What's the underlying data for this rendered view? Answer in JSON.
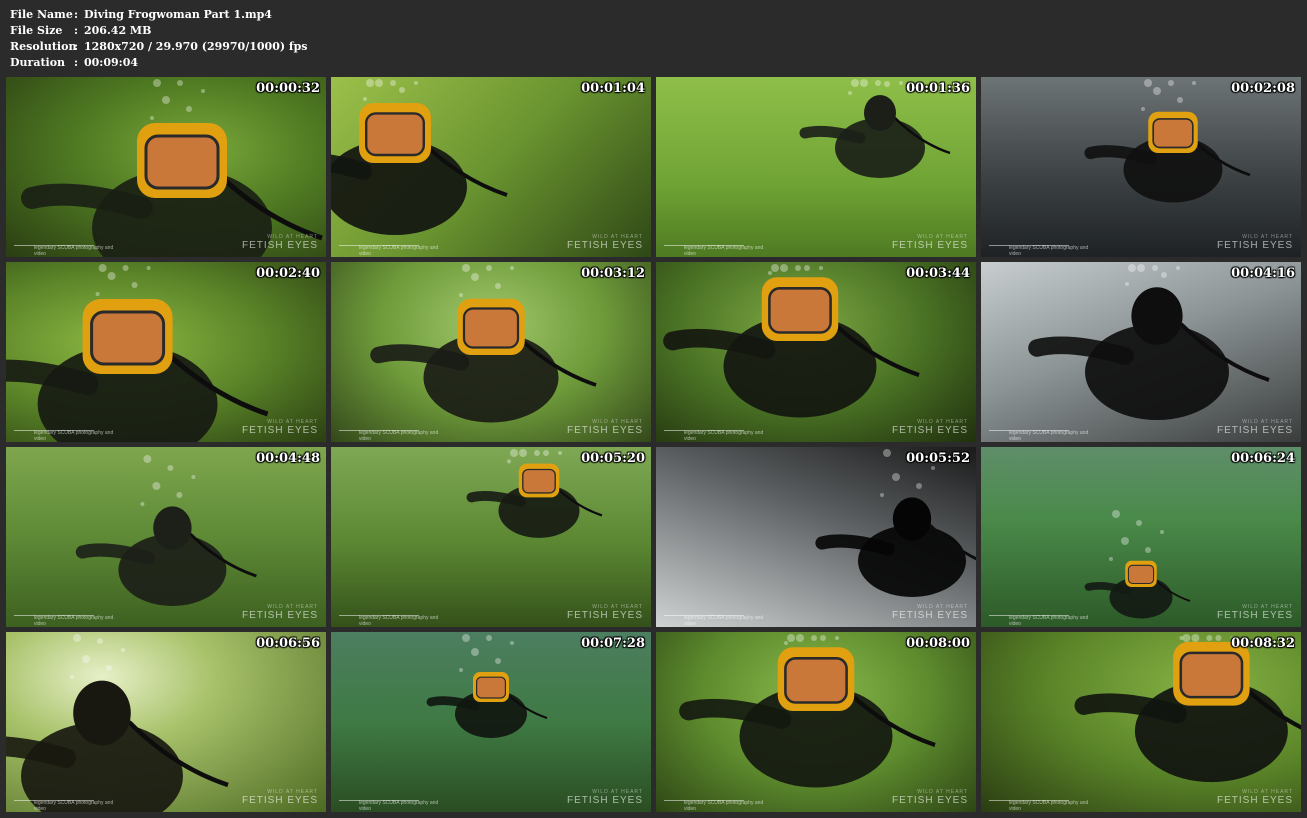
{
  "info": {
    "rows": [
      {
        "label": "File Name",
        "value": "Diving Frogwoman Part 1.mp4"
      },
      {
        "label": "File Size",
        "value": "206.42 MB"
      },
      {
        "label": "Resolution",
        "value": "1280x720 / 29.970 (29970/1000) fps"
      },
      {
        "label": "Duration",
        "value": "00:09:04"
      }
    ]
  },
  "watermark": {
    "left_subtitle": "legendary SCUBA photography and video",
    "right_small": "WILD AT HEART",
    "right_brand": "FETISH EYES"
  },
  "thumbnails": [
    {
      "time": "00:00:32",
      "scene": "diver-closeup-yellow-helmet"
    },
    {
      "time": "00:01:04",
      "scene": "diver-arm-hose"
    },
    {
      "time": "00:01:36",
      "scene": "diver-reaching-hand"
    },
    {
      "time": "00:02:08",
      "scene": "diver-surface-water"
    },
    {
      "time": "00:02:40",
      "scene": "diver-mask-closeup"
    },
    {
      "time": "00:03:12",
      "scene": "diver-front-bubbles"
    },
    {
      "time": "00:03:44",
      "scene": "diver-mask-bright"
    },
    {
      "time": "00:04:16",
      "scene": "diver-silhouette"
    },
    {
      "time": "00:04:48",
      "scene": "diver-distant-upright"
    },
    {
      "time": "00:05:20",
      "scene": "diver-arms-out"
    },
    {
      "time": "00:05:52",
      "scene": "diver-bubbles-dark"
    },
    {
      "time": "00:06:24",
      "scene": "diver-far-bottom"
    },
    {
      "time": "00:06:56",
      "scene": "diver-bright-overhead"
    },
    {
      "time": "00:07:28",
      "scene": "diver-spread-arms"
    },
    {
      "time": "00:08:00",
      "scene": "diver-mask-arm"
    },
    {
      "time": "00:08:32",
      "scene": "diver-side-closeup"
    }
  ],
  "colors": {
    "background": "#2b2b2b",
    "water_green": "#5e8a2e",
    "helmet_yellow": "#e0a010"
  }
}
